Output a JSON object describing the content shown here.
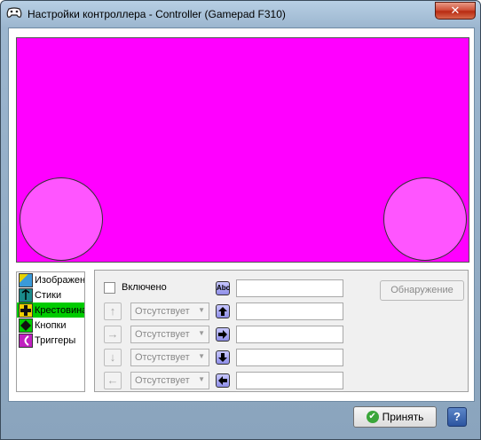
{
  "window": {
    "title": "Настройки контроллера - Controller (Gamepad F310)",
    "app_icon": "gamepad-icon",
    "close_label": "✕"
  },
  "categories": [
    {
      "label": "Изображен",
      "icon": "image-icon",
      "color": "#3a9ad9"
    },
    {
      "label": "Стики",
      "icon": "stick-icon",
      "color": "#1a8a8a"
    },
    {
      "label": "Крестовина",
      "icon": "dpad-icon",
      "color": "#f0d000",
      "selected": true
    },
    {
      "label": "Кнопки",
      "icon": "button-icon",
      "color": "#111111"
    },
    {
      "label": "Триггеры",
      "icon": "trigger-icon",
      "color": "#c020c0"
    }
  ],
  "dpad_settings": {
    "enabled_label": "Включено",
    "enabled": false,
    "label_icon": "abc-icon",
    "label_icon_text": "Abc",
    "rows": [
      {
        "direction": "up",
        "arrow": "↑",
        "dropdown": "Отсутствует",
        "icon_text": "🡅",
        "value": ""
      },
      {
        "direction": "right",
        "arrow": "→",
        "dropdown": "Отсутствует",
        "icon_text": "🡆",
        "value": ""
      },
      {
        "direction": "down",
        "arrow": "↓",
        "dropdown": "Отсутствует",
        "icon_text": "🡇",
        "value": ""
      },
      {
        "direction": "left",
        "arrow": "←",
        "dropdown": "Отсутствует",
        "icon_text": "🡄",
        "value": ""
      }
    ],
    "detect_label": "Обнаружение"
  },
  "footer": {
    "accept_label": "Принять",
    "help_label": "?"
  },
  "colors": {
    "canvas_background": "#ff00ff",
    "stick_fill": "#ff55ff",
    "selected_category": "#00cc00"
  }
}
